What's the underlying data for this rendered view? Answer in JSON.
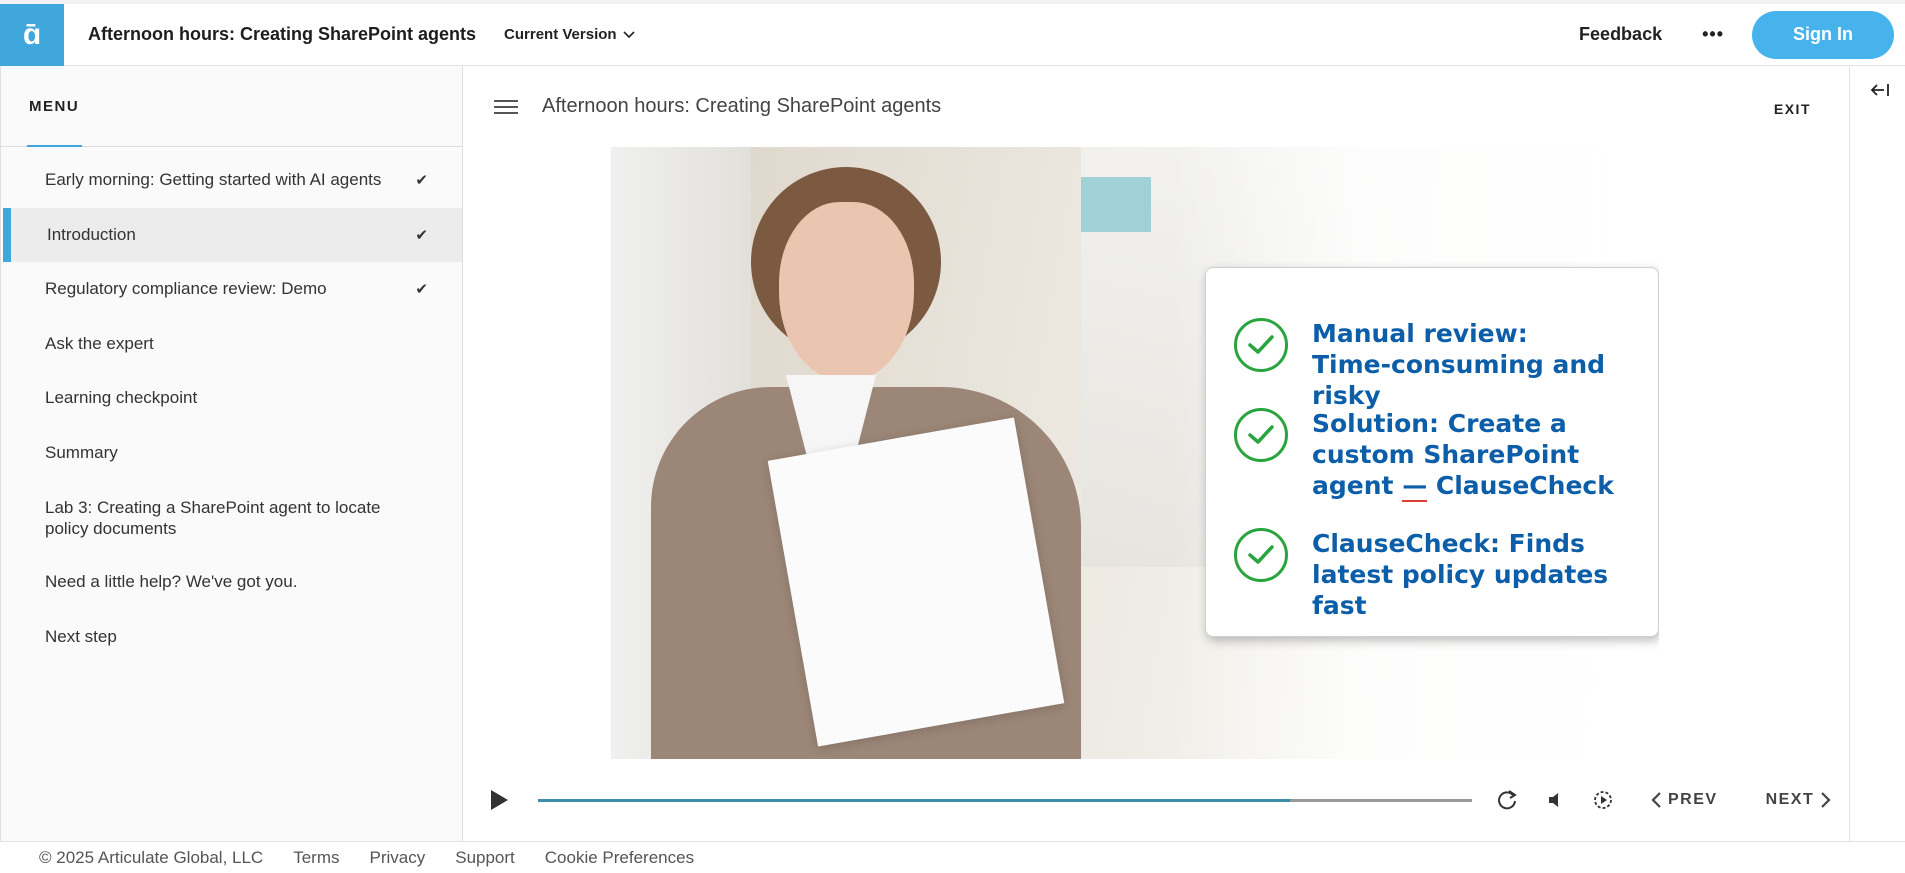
{
  "header": {
    "logo_glyph": "ɑ̄",
    "course_title": "Afternoon hours: Creating SharePoint agents",
    "version_label": "Current Version",
    "feedback_label": "Feedback",
    "more_label": "•••",
    "signin_label": "Sign In"
  },
  "sidebar": {
    "menu_label": "MENU",
    "items": [
      {
        "label": "Early morning: Getting started with AI agents",
        "completed": true
      },
      {
        "label": "Introduction",
        "completed": true
      },
      {
        "label": "Regulatory compliance review: Demo",
        "completed": true
      },
      {
        "label": "Ask the expert",
        "completed": false
      },
      {
        "label": "Learning checkpoint",
        "completed": false
      },
      {
        "label": "Summary",
        "completed": false
      },
      {
        "label": "Lab 3: Creating a SharePoint agent to locate policy documents",
        "completed": false
      },
      {
        "label": "Need a little help? We've got you.",
        "completed": false
      },
      {
        "label": "Next step",
        "completed": false
      }
    ],
    "active_index": 1
  },
  "lesson": {
    "title": "Afternoon hours: Creating SharePoint agents",
    "exit_label": "EXIT"
  },
  "callout": {
    "line1a": "Manual review:",
    "line1b": "Time-consuming and risky",
    "line2a": "Solution: Create a",
    "line2b": "custom SharePoint",
    "line2c_prefix": "agent ",
    "line2c_dash": "—",
    "line2c_suffix": " ClauseCheck",
    "line3a": "ClauseCheck: Finds",
    "line3b": "latest policy updates fast"
  },
  "player": {
    "progress": 0.805,
    "prev_label": "PREV",
    "next_label": "NEXT"
  },
  "footer": {
    "copyright": "© 2025 Articulate Global, LLC",
    "links": [
      "Terms",
      "Privacy",
      "Support",
      "Cookie Preferences"
    ]
  },
  "colors": {
    "accent": "#3fa7dc",
    "check_green": "#2aa43e",
    "callout_text": "#0d5ea8",
    "progress_fill": "#3c8fa8"
  }
}
